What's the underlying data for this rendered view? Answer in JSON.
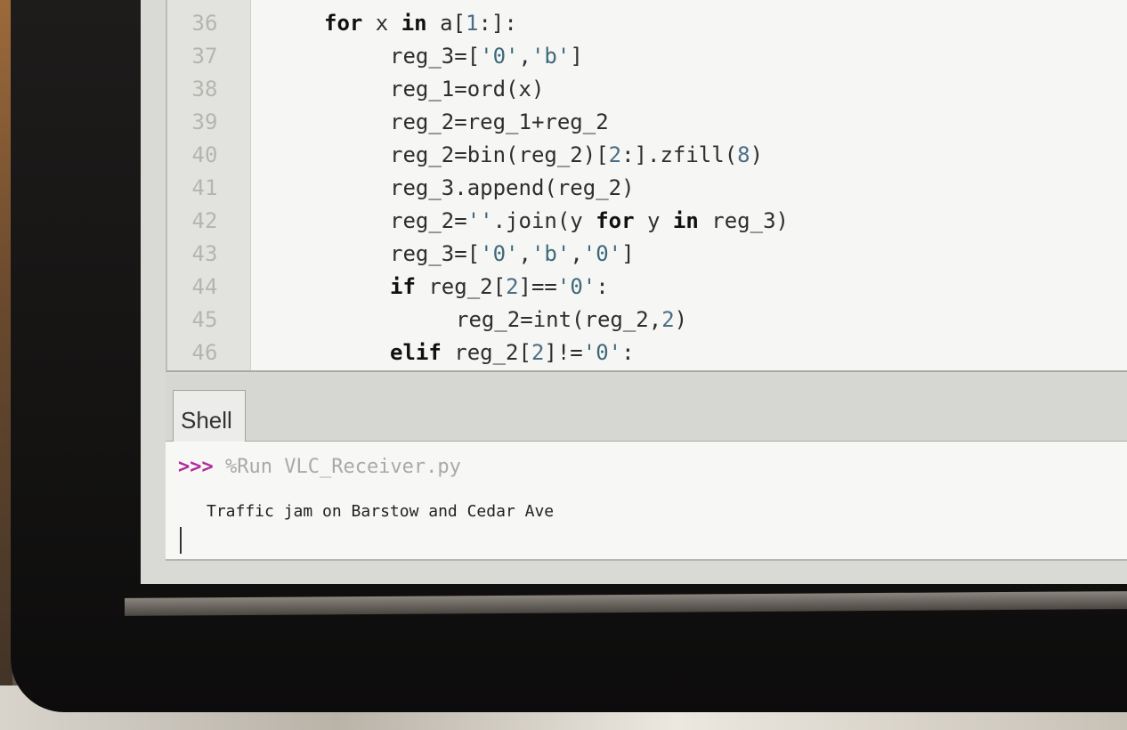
{
  "editor": {
    "lines": [
      {
        "num": "36",
        "code": "for x in a[1:]:"
      },
      {
        "num": "37",
        "code": "reg_3=['0','b']"
      },
      {
        "num": "38",
        "code": "reg_1=ord(x)"
      },
      {
        "num": "39",
        "code": "reg_2=reg_1+reg_2"
      },
      {
        "num": "40",
        "code": "reg_2=bin(reg_2)[2:].zfill(8)"
      },
      {
        "num": "41",
        "code": "reg_3.append(reg_2)"
      },
      {
        "num": "42",
        "code": "reg_2=''.join(y for y in reg_3)"
      },
      {
        "num": "43",
        "code": "reg_3=['0','b','0']"
      },
      {
        "num": "44",
        "code": "if reg_2[2]=='0':"
      },
      {
        "num": "45",
        "code": "reg_2=int(reg_2,2)"
      },
      {
        "num": "46",
        "code": "elif reg_2[2]!='0':"
      }
    ]
  },
  "shell": {
    "tab_label": "Shell",
    "prompt_symbol": ">>>",
    "command": "%Run VLC_Receiver.py",
    "output": "Traffic jam on Barstow and Cedar Ave"
  }
}
